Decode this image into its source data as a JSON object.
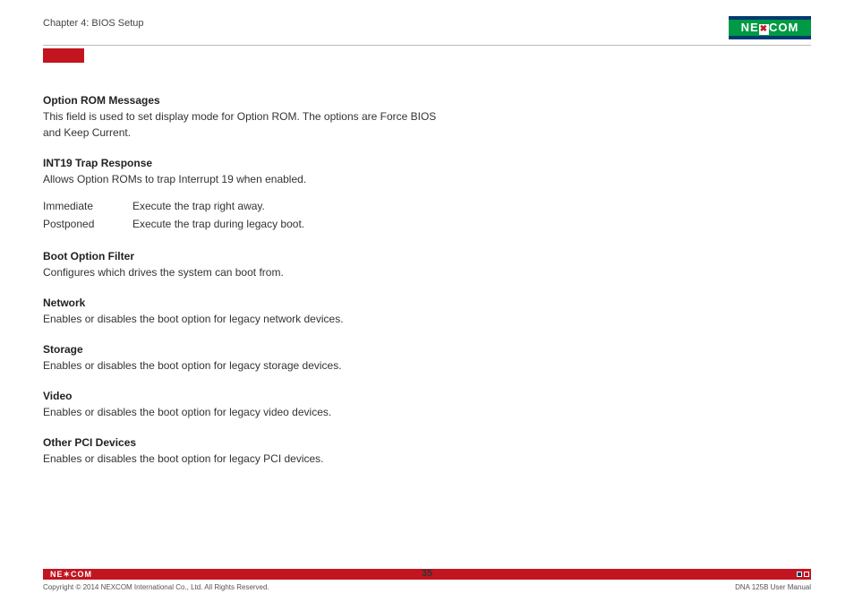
{
  "header": {
    "chapter": "Chapter 4: BIOS Setup",
    "brand": "NEXCOM"
  },
  "sections": {
    "optionRom": {
      "title": "Option ROM Messages",
      "body": "This field is used to set display mode for Option ROM. The options are Force BIOS and Keep Current."
    },
    "int19": {
      "title": "INT19 Trap Response",
      "body": "Allows Option ROMs to trap Interrupt 19 when enabled.",
      "rows": [
        {
          "label": "Immediate",
          "desc": "Execute the trap right away."
        },
        {
          "label": "Postponed",
          "desc": "Execute the trap during legacy boot."
        }
      ]
    },
    "bootFilter": {
      "title": "Boot Option Filter",
      "body": "Configures which drives the system can boot from."
    },
    "network": {
      "title": "Network",
      "body": "Enables or disables the boot option for legacy network devices."
    },
    "storage": {
      "title": "Storage",
      "body": "Enables or disables the boot option for legacy storage devices."
    },
    "video": {
      "title": "Video",
      "body": "Enables or disables the boot option for legacy video devices."
    },
    "otherPci": {
      "title": "Other PCI Devices",
      "body": "Enables or disables the boot option for legacy PCI devices."
    }
  },
  "footer": {
    "brand": "NE✶COM",
    "copyright": "Copyright © 2014 NEXCOM International Co., Ltd. All Rights Reserved.",
    "pageNumber": "35",
    "manual": "DNA 125B User Manual"
  }
}
